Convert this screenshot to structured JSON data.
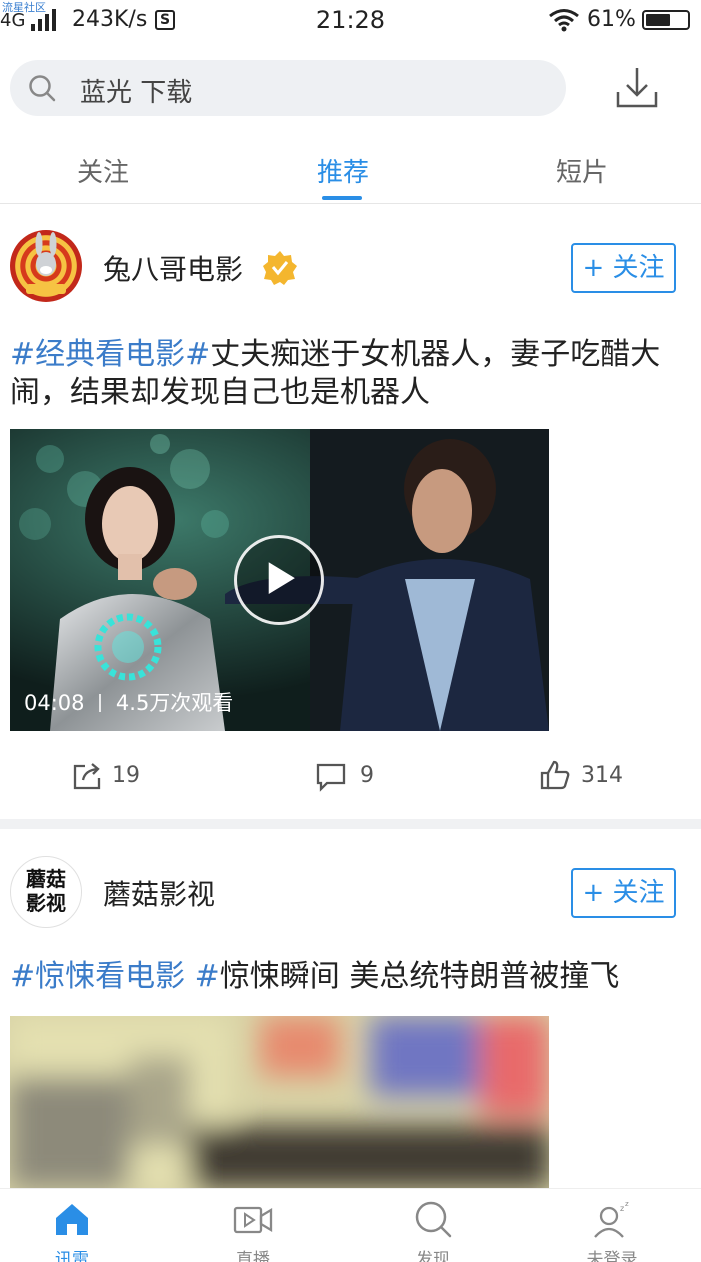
{
  "status_bar": {
    "watermark": "流星社区",
    "network": "4G",
    "speed": "243K/s",
    "s_icon": "S",
    "time": "21:28",
    "battery_pct": "61%",
    "battery_level": 0.61
  },
  "search": {
    "query": "蓝光 下载",
    "icon": "search-icon",
    "download_icon": "download-icon"
  },
  "tabs": [
    {
      "label": "关注",
      "active": false
    },
    {
      "label": "推荐",
      "active": true
    },
    {
      "label": "短片",
      "active": false
    }
  ],
  "posts": [
    {
      "author": "兔八哥电影",
      "verified": true,
      "follow_label": "+ 关注",
      "tag": "#经典看电影#",
      "title": "丈夫痴迷于女机器人，妻子吃醋大闹，结果却发现自己也是机器人",
      "duration": "04:08",
      "views": "4.5万次观看",
      "shares": "19",
      "comments": "9",
      "likes": "314"
    },
    {
      "author": "蘑菇影视",
      "avatar_text_1": "蘑菇",
      "avatar_text_2": "影视",
      "follow_label": "+ 关注",
      "tag": "#惊悚看电影 #",
      "title": "惊悚瞬间 美总统特朗普被撞飞"
    }
  ],
  "bottom_nav": [
    {
      "label": "讯雷",
      "icon": "home-icon",
      "active": true
    },
    {
      "label": "直播",
      "icon": "live-video-icon",
      "active": false
    },
    {
      "label": "发现",
      "icon": "discover-icon",
      "active": false
    },
    {
      "label": "未登录",
      "icon": "user-icon",
      "active": false
    }
  ],
  "colors": {
    "accent": "#2a8ee6",
    "tag": "#3b7cc9",
    "search_bg": "#eef0f3"
  }
}
